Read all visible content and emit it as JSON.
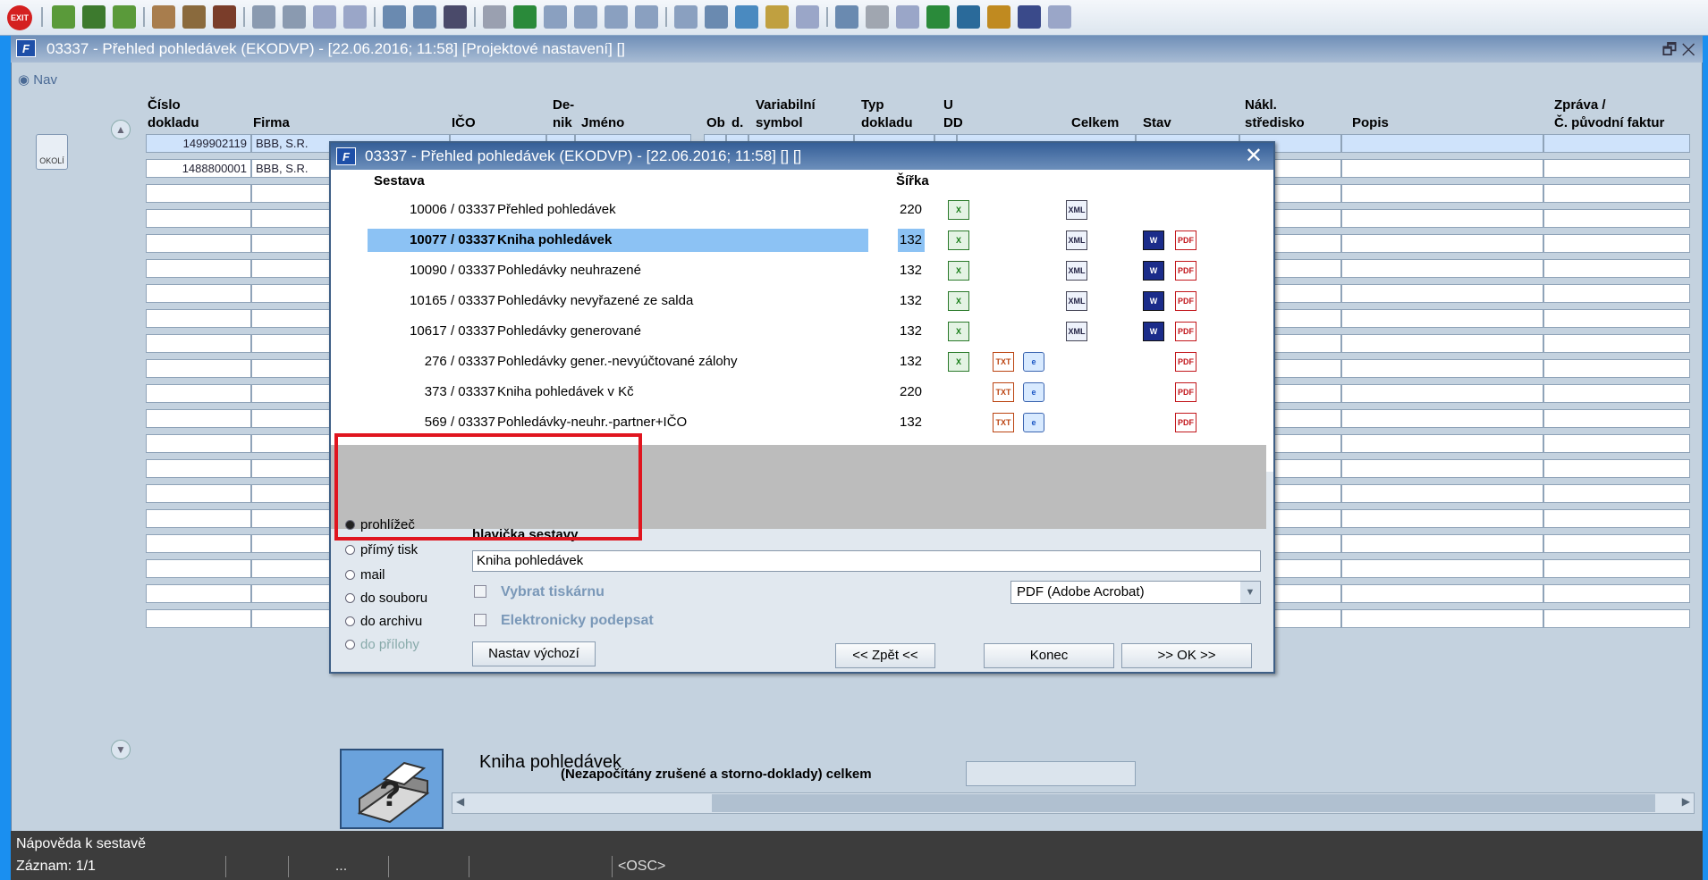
{
  "toolbar": {
    "exit_label": "EXIT"
  },
  "window": {
    "title": "03337 - Přehled pohledávek (EKODVP) - [22.06.2016; 11:58] [Projektové nastavení] []",
    "controls": "🗗 ✕"
  },
  "nav": {
    "tab_label": "Nav",
    "sidebar_icon_label": "OKOLÍ"
  },
  "grid": {
    "headers": {
      "cislo": "Číslo",
      "dokladu": "dokladu",
      "firma": "Firma",
      "ico": "IČO",
      "de": "De-",
      "nik": "nik",
      "jmeno": "Jméno",
      "ob": "Ob",
      "d": "d.",
      "var1": "Variabilní",
      "var2": "symbol",
      "typ1": "Typ",
      "typ2": "dokladu",
      "u1": "U",
      "u2": "DD",
      "celkem": "Celkem",
      "stav": "Stav",
      "nakl1": "Nákl.",
      "nakl2": "středisko",
      "popis": "Popis",
      "zprava1": "Zpráva /",
      "zprava2": "Č. původní faktur"
    },
    "rows": [
      {
        "cislo": "1499902119",
        "firma": "BBB, S.R."
      },
      {
        "cislo": "1488800001",
        "firma": "BBB, S.R."
      }
    ],
    "totals_label": "(Nezapočítány zrušené a storno-doklady) celkem"
  },
  "status": {
    "line1": "Nápověda k sestavě",
    "record": "Záznam: 1/1",
    "dots": "...",
    "osc": "<OSC>"
  },
  "dialog": {
    "title": "03337 - Přehled pohledávek (EKODVP) - [22.06.2016; 11:58] [] []",
    "col_sestava": "Sestava",
    "col_sirka": "Šířka",
    "reports": [
      {
        "code": "10006 / 03337",
        "name": "Přehled pohledávek",
        "width": "220"
      },
      {
        "code": "10077 / 03337",
        "name": "Kniha pohledávek",
        "width": "132"
      },
      {
        "code": "10090 / 03337",
        "name": "Pohledávky neuhrazené",
        "width": "132"
      },
      {
        "code": "10165 / 03337",
        "name": "Pohledávky nevyřazené ze salda",
        "width": "132"
      },
      {
        "code": "10617 / 03337",
        "name": "Pohledávky generované",
        "width": "132"
      },
      {
        "code": "276 / 03337",
        "name": "Pohledávky gener.-nevyúčtované zálohy",
        "width": "132"
      },
      {
        "code": "373 / 03337",
        "name": "Kniha pohledávek v Kč",
        "width": "220"
      },
      {
        "code": "569 / 03337",
        "name": "Pohledávky-neuhr.-partner+IČO",
        "width": "132"
      }
    ],
    "preview_title": "Kniha pohledávek",
    "output_options": [
      "prohlížeč",
      "přímý tisk",
      "mail",
      "do souboru",
      "do archivu",
      "do přílohy"
    ],
    "header_label": "hlavička sestavy",
    "header_value": "Kniha pohledávek",
    "chk_printer": "Vybrat tiskárnu",
    "chk_sign": "Elektronicky podepsat",
    "printer_value": "PDF (Adobe Acrobat)",
    "btn_default": "Nastav výchozí",
    "btn_back": "<< Zpět <<",
    "btn_end": "Konec",
    "btn_ok": ">> OK >>",
    "file_icons": {
      "xls": "X",
      "xml": "XML",
      "doc": "W",
      "pdf": "PDF",
      "txt": "TXT",
      "web": "e"
    }
  }
}
